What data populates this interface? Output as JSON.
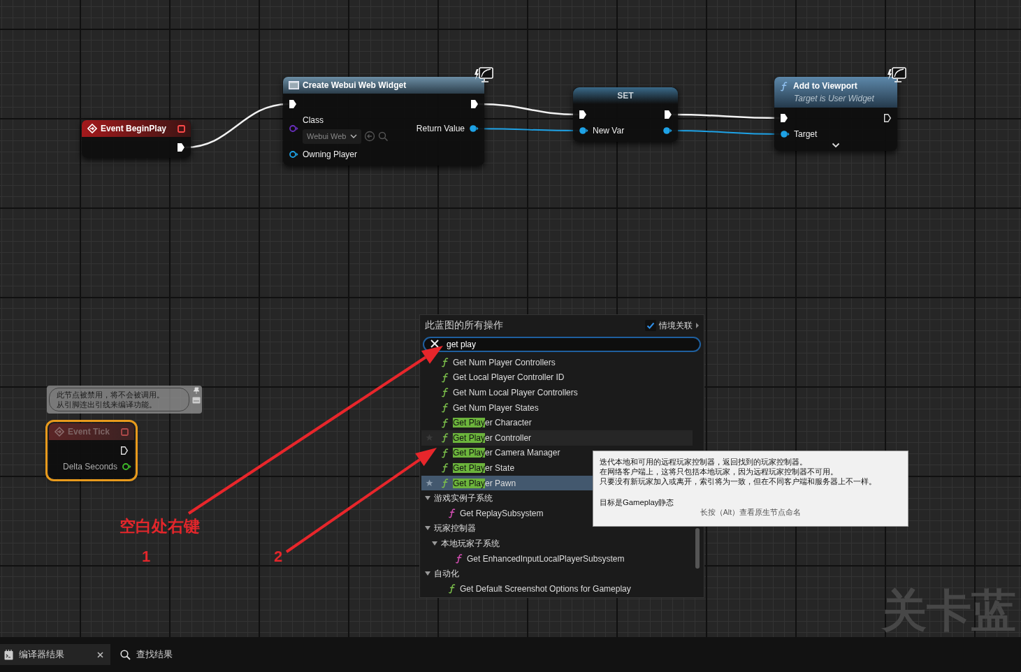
{
  "nodes": [
    {
      "kind": "event",
      "title": "Event BeginPlay",
      "selected": false,
      "disabled": false,
      "rows": [
        {
          "right": {
            "kind": "exec",
            "connected": true
          }
        }
      ]
    },
    {
      "kind": "call",
      "title": "Create Webui Web Widget",
      "client_only": true,
      "selected": false,
      "disabled": false,
      "rows": [
        {
          "left": {
            "kind": "exec",
            "connected": true
          },
          "right": {
            "kind": "exec",
            "connected": true
          }
        },
        {
          "left": {
            "kind": "data",
            "label": "Class",
            "color": "#6a2fc0",
            "connected": false,
            "dropdown": "Webui Web"
          },
          "right": {
            "kind": "data",
            "label": "Return Value",
            "color": "#1ea2e6",
            "connected": true
          }
        },
        {
          "left": {
            "kind": "data",
            "label": "Owning Player",
            "color": "#1ea2e6",
            "connected": false
          }
        }
      ]
    },
    {
      "kind": "set",
      "title": "SET",
      "selected": false,
      "disabled": false,
      "rows": [
        {
          "left": {
            "kind": "exec",
            "connected": true
          },
          "right": {
            "kind": "exec",
            "connected": true
          }
        },
        {
          "left": {
            "kind": "data",
            "label": "New Var",
            "color": "#1ea2e6",
            "connected": true
          },
          "right": {
            "kind": "data",
            "color": "#1ea2e6",
            "connected": true
          }
        }
      ]
    },
    {
      "kind": "function",
      "title": "Add to Viewport",
      "subtitle": "Target is User Widget",
      "client_only": true,
      "advanced_pins": true,
      "selected": false,
      "disabled": false,
      "rows": [
        {
          "left": {
            "kind": "exec",
            "connected": true
          },
          "right": {
            "kind": "exec",
            "connected": false
          }
        },
        {
          "left": {
            "kind": "data",
            "label": "Target",
            "color": "#1ea2e6",
            "connected": true
          }
        }
      ]
    },
    {
      "kind": "event",
      "title": "Event Tick",
      "selected": true,
      "disabled": true,
      "comment": [
        "此节点被禁用，将不会被调用。",
        "从引脚连出引线来编译功能。"
      ],
      "rows": [
        {
          "right": {
            "kind": "exec",
            "connected": false
          }
        },
        {
          "right": {
            "kind": "data",
            "label": "Delta Seconds",
            "color": "#3fbf2a",
            "connected": false
          }
        }
      ]
    }
  ],
  "action_menu": {
    "title": "此蓝图的所有操作",
    "context": {
      "label": "情境关联",
      "checked": true
    },
    "search": {
      "value": "get play"
    },
    "results": [
      {
        "kind": "function",
        "label": "Get Num Player Controllers",
        "color": "#7cc04b",
        "match": false,
        "selected": false,
        "hovered": false
      },
      {
        "kind": "function",
        "label": "Get Local Player Controller ID",
        "color": "#7cc04b",
        "match": false,
        "selected": false,
        "hovered": false
      },
      {
        "kind": "function",
        "label": "Get Num Local Player Controllers",
        "color": "#7cc04b",
        "match": false,
        "selected": false,
        "hovered": false
      },
      {
        "kind": "function",
        "label": "Get Num Player States",
        "color": "#7cc04b",
        "match": false,
        "selected": false,
        "hovered": false
      },
      {
        "kind": "function",
        "label": "Get Player Character",
        "color": "#7cc04b",
        "match": true,
        "selected": false,
        "hovered": false
      },
      {
        "kind": "function",
        "label": "Get Player Controller",
        "color": "#7cc04b",
        "match": true,
        "selected": false,
        "hovered": true
      },
      {
        "kind": "function",
        "label": "Get Player Camera Manager",
        "color": "#7cc04b",
        "match": true,
        "selected": false,
        "hovered": false
      },
      {
        "kind": "function",
        "label": "Get Player State",
        "color": "#7cc04b",
        "match": true,
        "selected": false,
        "hovered": false
      },
      {
        "kind": "function",
        "label": "Get Player Pawn",
        "color": "#7cc04b",
        "match": true,
        "selected": true,
        "hovered": false
      },
      {
        "kind": "category",
        "label": "游戏实例子系统",
        "expanded": true,
        "children": [
          {
            "kind": "function",
            "label": "Get ReplaySubsystem",
            "color": "#d64fb5",
            "match": false,
            "selected": false,
            "hovered": false
          }
        ]
      },
      {
        "kind": "category",
        "label": "玩家控制器",
        "expanded": true,
        "children": [
          {
            "kind": "category",
            "label": "本地玩家子系统",
            "expanded": true,
            "children": [
              {
                "kind": "function",
                "label": "Get EnhancedInputLocalPlayerSubsystem",
                "color": "#d64fb5",
                "match": false,
                "selected": false,
                "hovered": false
              }
            ]
          }
        ]
      },
      {
        "kind": "category",
        "label": "自动化",
        "expanded": true,
        "children": [
          {
            "kind": "function",
            "label": "Get Default Screenshot Options for Gameplay",
            "color": "#7cc04b",
            "match": false,
            "selected": false,
            "hovered": false
          }
        ]
      }
    ]
  },
  "tooltip": {
    "lines": [
      "迭代本地和可用的远程玩家控制器，返回找到的玩家控制器。",
      "在网络客户端上，这将只包括本地玩家，因为远程玩家控制器不可用。",
      "只要没有新玩家加入或离开，索引将为一致，但在不同客户端和服务器上不一样。"
    ],
    "target": "目标是Gameplay静态",
    "hint": "长按（Alt）查看原生节点命名"
  },
  "graph_label": "关卡蓝",
  "annotations": {
    "caption": "空白处右键",
    "steps": [
      "1",
      "2"
    ]
  },
  "bottom_tabs": [
    {
      "label": "编译器结果",
      "selected": true,
      "closable": true
    },
    {
      "label": "查找结果",
      "selected": false,
      "closable": false
    }
  ]
}
